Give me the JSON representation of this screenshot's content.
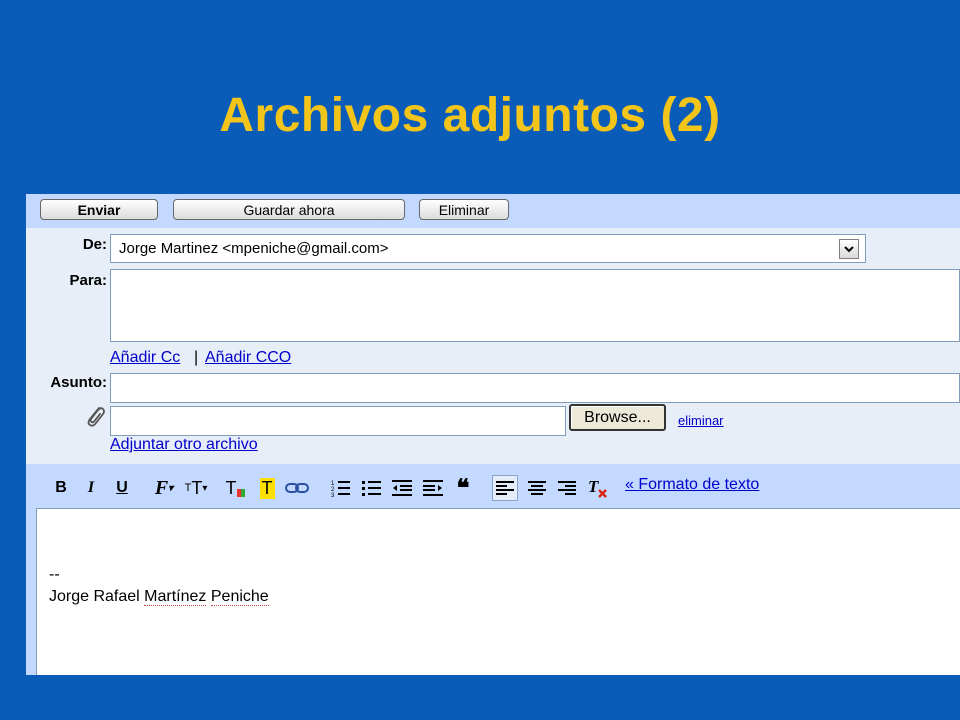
{
  "slide": {
    "title": "Archivos adjuntos (2)",
    "title_color": "#f3c51a",
    "background_color": "#0a5cb8"
  },
  "toolbar": {
    "send_label": "Enviar",
    "save_label": "Guardar ahora",
    "delete_label": "Eliminar"
  },
  "header": {
    "from_label": "De:",
    "from_value": "Jorge Martinez <mpeniche@gmail.com>",
    "to_label": "Para:",
    "to_value": "",
    "add_cc": "Añadir Cc",
    "separator": "|",
    "add_bcc": "Añadir CCO",
    "subject_label": "Asunto:",
    "subject_value": "",
    "attach_icon": "paperclip-icon",
    "attachment_value": "",
    "browse_label": "Browse...",
    "remove_label": "eliminar",
    "attach_another": "Adjuntar otro archivo"
  },
  "format_toolbar": {
    "bold": "B",
    "italic": "I",
    "underline": "U",
    "font": "F",
    "size": "T",
    "text_color": "T",
    "highlight": "T",
    "link_icon": "link-icon",
    "numbered_list_icon": "numbered-list-icon",
    "bullet_list_icon": "bullet-list-icon",
    "outdent_icon": "outdent-icon",
    "indent_icon": "indent-icon",
    "quote": "❝",
    "align_left_icon": "align-left-icon",
    "align_center_icon": "align-center-icon",
    "align_right_icon": "align-right-icon",
    "clear_format_icon": "clear-format-icon",
    "plain_text_link": "« Formato de texto"
  },
  "body": {
    "signature_sep": "--",
    "signature_first": "Jorge Rafael",
    "signature_word1": "Martínez",
    "signature_word2": "Peniche"
  }
}
